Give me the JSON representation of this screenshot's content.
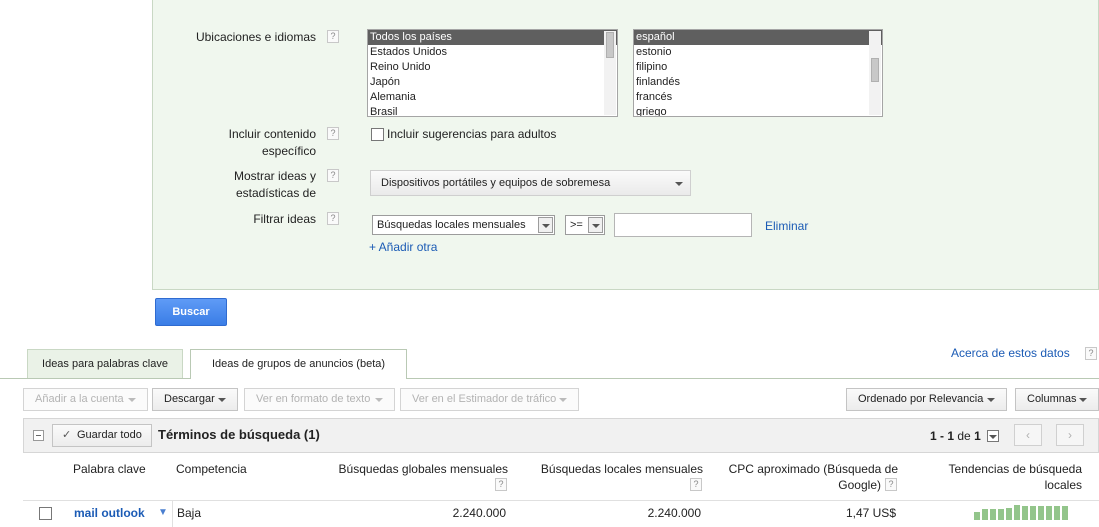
{
  "panel": {
    "locations_label": "Ubicaciones e idiomas",
    "help_glyph": "?",
    "countries": [
      "Todos los países",
      "Estados Unidos",
      "Reino Unido",
      "Japón",
      "Alemania",
      "Brasil"
    ],
    "languages": [
      "español",
      "estonio",
      "filipino",
      "finlandés",
      "francés",
      "griego"
    ],
    "include_label_1": "Incluir contenido",
    "include_label_2": "específico",
    "adult_checkbox_label": "Incluir sugerencias para adultos",
    "show_label_1": "Mostrar ideas y",
    "show_label_2": "estadísticas de",
    "devices_value": "Dispositivos portátiles y equipos de sobremesa",
    "filter_label": "Filtrar ideas",
    "filter_metric": "Búsquedas locales mensuales",
    "filter_operator": ">=",
    "filter_value": "",
    "remove_link": "Eliminar",
    "add_link": "+ Añadir otra"
  },
  "search_button": "Buscar",
  "tabs": [
    {
      "label": "Ideas para palabras clave",
      "active": false
    },
    {
      "label": "Ideas de grupos de anuncios (beta)",
      "active": true
    }
  ],
  "about_link": "Acerca de estos datos",
  "toolbar": {
    "add_to_account": "Añadir a la cuenta",
    "download": "Descargar",
    "view_text": "Ver en formato de texto",
    "view_estimator": "Ver en el Estimador de tráfico",
    "sort": "Ordenado por Relevancia",
    "columns": "Columnas"
  },
  "table": {
    "save_all": "Guardar todo",
    "title": "Términos de búsqueda (1)",
    "pagination_range": "1 - 1",
    "pagination_of": "de",
    "pagination_total": "1",
    "prev_glyph": "‹",
    "next_glyph": "›",
    "columns": {
      "keyword": "Palabra clave",
      "competition": "Competencia",
      "global_1": "Búsquedas globales mensuales",
      "local_1": "Búsquedas locales mensuales",
      "cpc_1": "CPC aproximado (Búsqueda de",
      "cpc_2": "Google)",
      "trend_1": "Tendencias de búsqueda",
      "trend_2": "locales"
    },
    "rows": [
      {
        "keyword": "mail outlook",
        "competition": "Baja",
        "global": "2.240.000",
        "local": "2.240.000",
        "cpc": "1,47 US$",
        "trend": [
          0.55,
          0.7,
          0.75,
          0.75,
          0.8,
          1.0,
          0.95,
          0.95,
          0.95,
          0.95,
          0.95,
          0.95
        ]
      }
    ]
  },
  "colors": {
    "panel_bg": "#f0f7ee",
    "primary_button": "#3a7de6",
    "link": "#1b5bb5",
    "trend_bar": "#93c58b"
  }
}
